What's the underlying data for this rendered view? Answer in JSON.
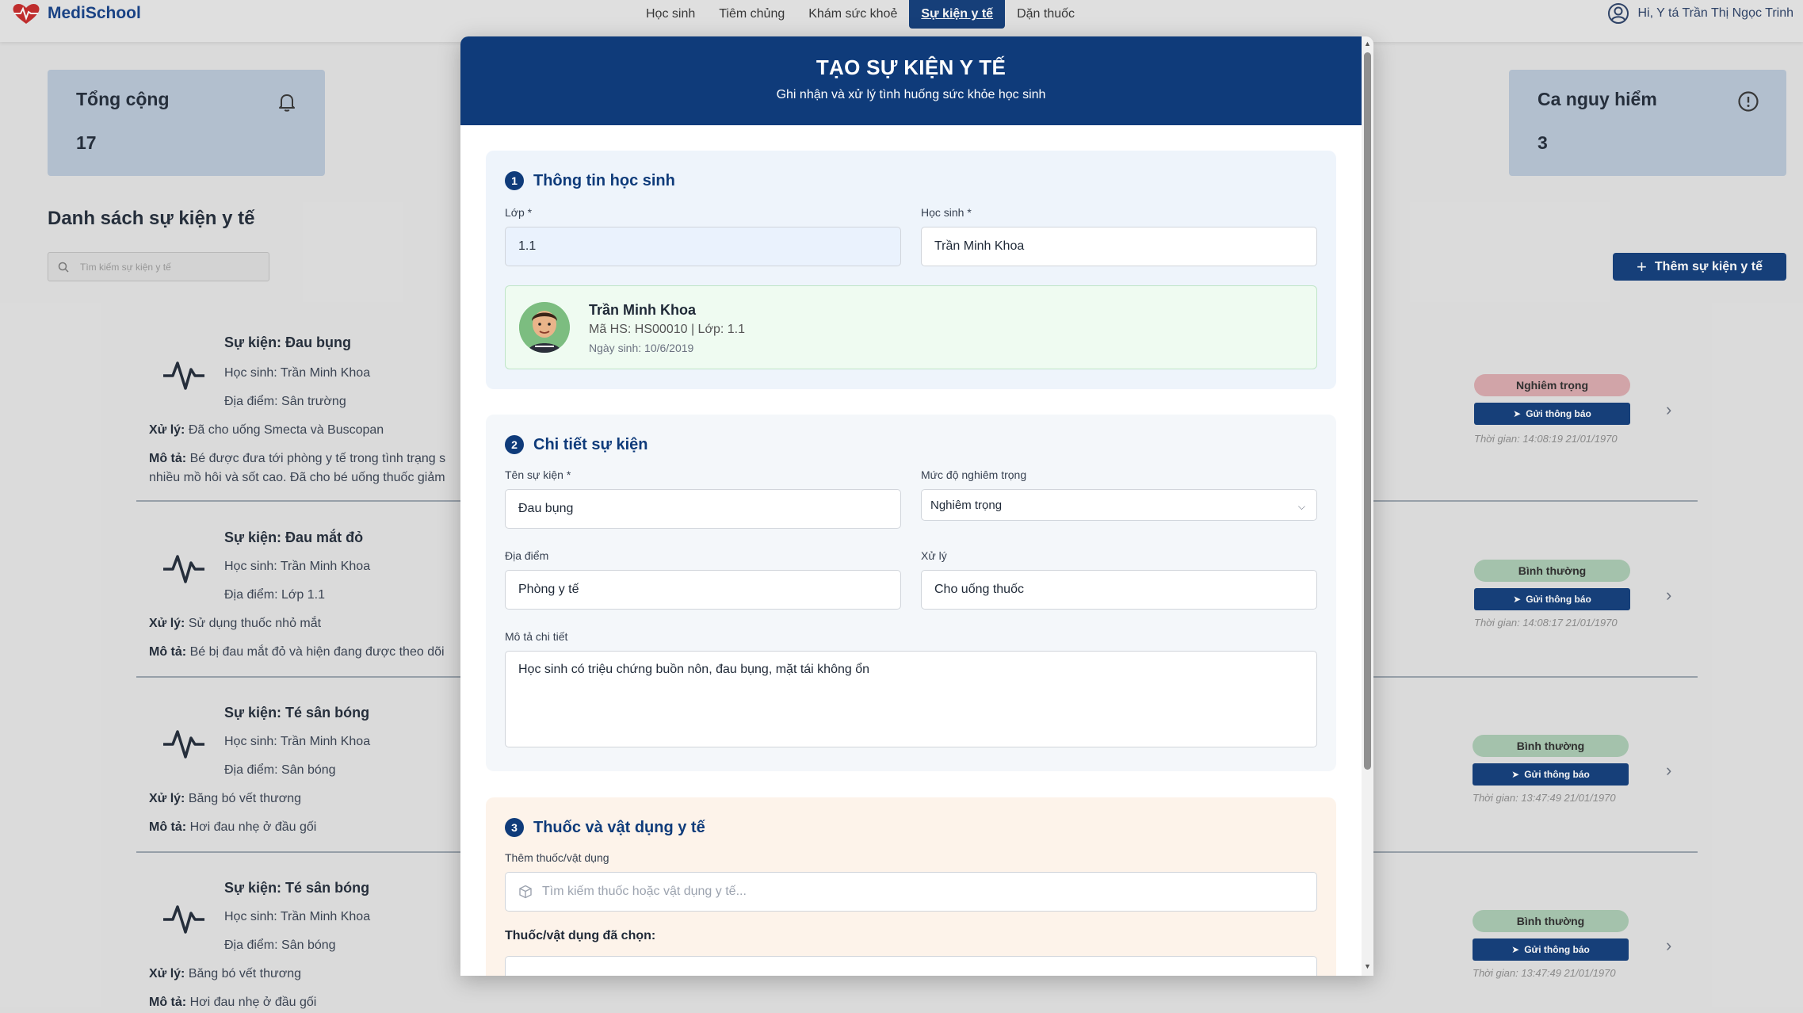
{
  "app": {
    "name": "MediSchool"
  },
  "nav": {
    "items": [
      {
        "label": "Học sinh",
        "active": false
      },
      {
        "label": "Tiêm chủng",
        "active": false
      },
      {
        "label": "Khám sức khoẻ",
        "active": false
      },
      {
        "label": "Sự kiện y tế",
        "active": true
      },
      {
        "label": "Dặn thuốc",
        "active": false
      }
    ],
    "user_greeting": "Hi, Y tá Trần Thị Ngọc Trinh"
  },
  "stats": {
    "total": {
      "title": "Tổng cộng",
      "value": "17",
      "icon": "bell-icon"
    },
    "danger": {
      "title": "Ca nguy hiểm",
      "value": "3",
      "icon": "alert-circle-icon"
    }
  },
  "list": {
    "title": "Danh sách sự kiện y tế",
    "search_placeholder": "Tìm kiếm sự kiện y tế",
    "add_button": "Thêm sự kiện y tế",
    "notify_label": "Gửi thông báo",
    "events": [
      {
        "name": "Sự kiện: Đau bụng",
        "student": "Học sinh: Trần Minh Khoa",
        "location": "Địa điểm: Sân trường",
        "handling_label": "Xử lý:",
        "handling": "Đã cho uống Smecta và Buscopan",
        "desc_label": "Mô tả:",
        "desc": "Bé được đưa tới phòng y tế trong tình trạng s",
        "desc2": "nhiều mồ hôi và sốt cao. Đã cho bé uống thuốc giảm",
        "severity": "Nghiêm trọng",
        "time": "Thời gian: 14:08:19 21/01/1970"
      },
      {
        "name": "Sự kiện: Đau mắt đỏ",
        "student": "Học sinh: Trần Minh Khoa",
        "location": "Địa điểm: Lớp 1.1",
        "handling_label": "Xử lý:",
        "handling": "Sử dụng thuốc nhỏ mắt",
        "desc_label": "Mô tả:",
        "desc": "Bé bị đau mắt đỏ và hiện đang được theo dõi",
        "severity": "Bình thường",
        "time": "Thời gian: 14:08:17 21/01/1970"
      },
      {
        "name": "Sự kiện: Té sân bóng",
        "student": "Học sinh: Trần Minh Khoa",
        "location": "Địa điểm: Sân bóng",
        "handling_label": "Xử lý:",
        "handling": "Băng bó vết thương",
        "desc_label": "Mô tả:",
        "desc": "Hơi đau nhẹ ở đầu gối",
        "severity": "Bình thường",
        "time": "Thời gian: 13:47:49 21/01/1970"
      },
      {
        "name": "Sự kiện: Té sân bóng",
        "student": "Học sinh: Trần Minh Khoa",
        "location": "Địa điểm: Sân bóng",
        "handling_label": "Xử lý:",
        "handling": "Băng bó vết thương",
        "desc_label": "Mô tả:",
        "desc": "Hơi đau nhẹ ở đầu gối",
        "severity": "Bình thường",
        "time": "Thời gian: 13:47:49 21/01/1970"
      }
    ]
  },
  "modal": {
    "title": "TẠO SỰ KIỆN Y TẾ",
    "subtitle": "Ghi nhận và xử lý tình huống sức khỏe học sinh",
    "section1": {
      "num": "1",
      "title": "Thông tin học sinh",
      "class_label": "Lớp *",
      "class_value": "1.1",
      "student_label": "Học sinh *",
      "student_value": "Trần Minh Khoa",
      "card": {
        "name": "Trần Minh Khoa",
        "meta": "Mã HS: HS00010 | Lớp: 1.1",
        "dob": "Ngày sinh: 10/6/2019"
      }
    },
    "section2": {
      "num": "2",
      "title": "Chi tiết sự kiện",
      "event_name_label": "Tên sự kiện *",
      "event_name_value": "Đau bụng",
      "severity_label": "Mức độ nghiêm trọng",
      "severity_value": "Nghiêm trọng",
      "location_label": "Địa điểm",
      "location_value": "Phòng y tế",
      "handling_label": "Xử lý",
      "handling_value": "Cho uống thuốc",
      "desc_label": "Mô tả chi tiết",
      "desc_value": "Học sinh có triệu chứng buồn nôn, đau bụng, mặt tái không ổn"
    },
    "section3": {
      "num": "3",
      "title": "Thuốc và vật dụng y tế",
      "add_label": "Thêm thuốc/vật dụng",
      "search_placeholder": "Tìm kiếm thuốc hoặc vật dụng y tế...",
      "selected_label": "Thuốc/vật dụng đã chọn:"
    }
  }
}
